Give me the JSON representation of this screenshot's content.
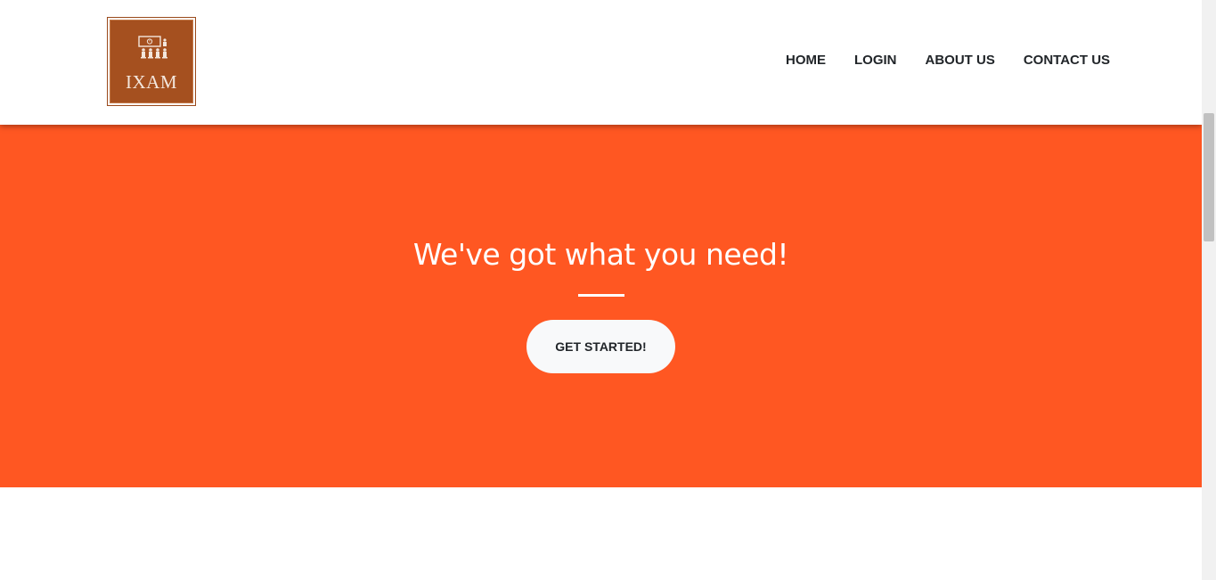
{
  "brand": {
    "logo_text": "IXAM",
    "logo_color": "#a5501f"
  },
  "nav": {
    "items": [
      {
        "label": "HOME"
      },
      {
        "label": "LOGIN"
      },
      {
        "label": "ABOUT US"
      },
      {
        "label": "CONTACT US"
      }
    ]
  },
  "hero": {
    "title": "We've got what you need!",
    "button_label": "GET STARTED!",
    "background_color": "#ff5722"
  }
}
